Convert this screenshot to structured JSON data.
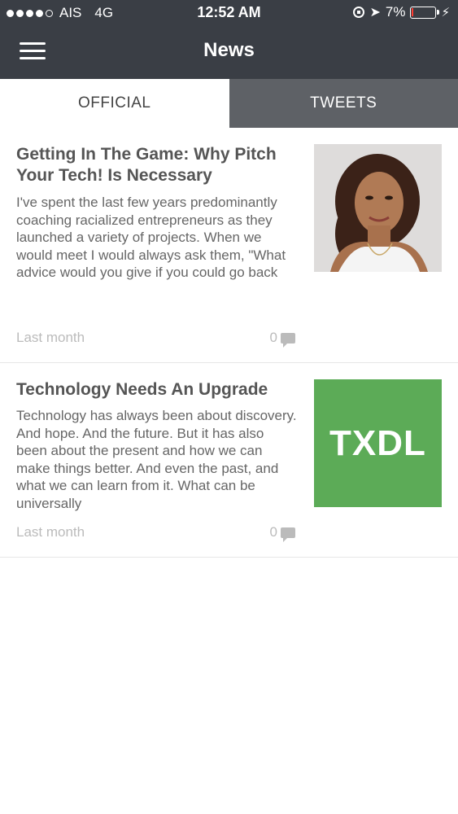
{
  "status_bar": {
    "carrier": "AIS",
    "network": "4G",
    "time": "12:52 AM",
    "battery": "7%",
    "battery_level": 0.07
  },
  "header": {
    "title": "News"
  },
  "tabs": [
    {
      "label": "OFFICIAL",
      "active": true
    },
    {
      "label": "TWEETS",
      "active": false
    }
  ],
  "articles": [
    {
      "title": "Getting In The Game: Why Pitch Your Tech! Is Necessary",
      "excerpt": "I've spent the last few years predominantly coaching racialized entrepreneurs as they launched a variety of projects.   When we would meet I would always ask them, \"What advice would you give if you could go back",
      "date": "Last month",
      "comments": "0",
      "image": "portrait-photo"
    },
    {
      "title": "Technology Needs An Upgrade",
      "excerpt": "Technology has always been about discovery. And hope. And the future. But it has also been about the present and how we can make things better. And even the past, and what we can learn from it. What can be universally",
      "date": "Last month",
      "comments": "0",
      "image_text": "TXDL"
    }
  ],
  "colors": {
    "header_bg": "#3a3e45",
    "inactive_tab_bg": "#5e6166",
    "txdl_green": "#5cab57"
  }
}
